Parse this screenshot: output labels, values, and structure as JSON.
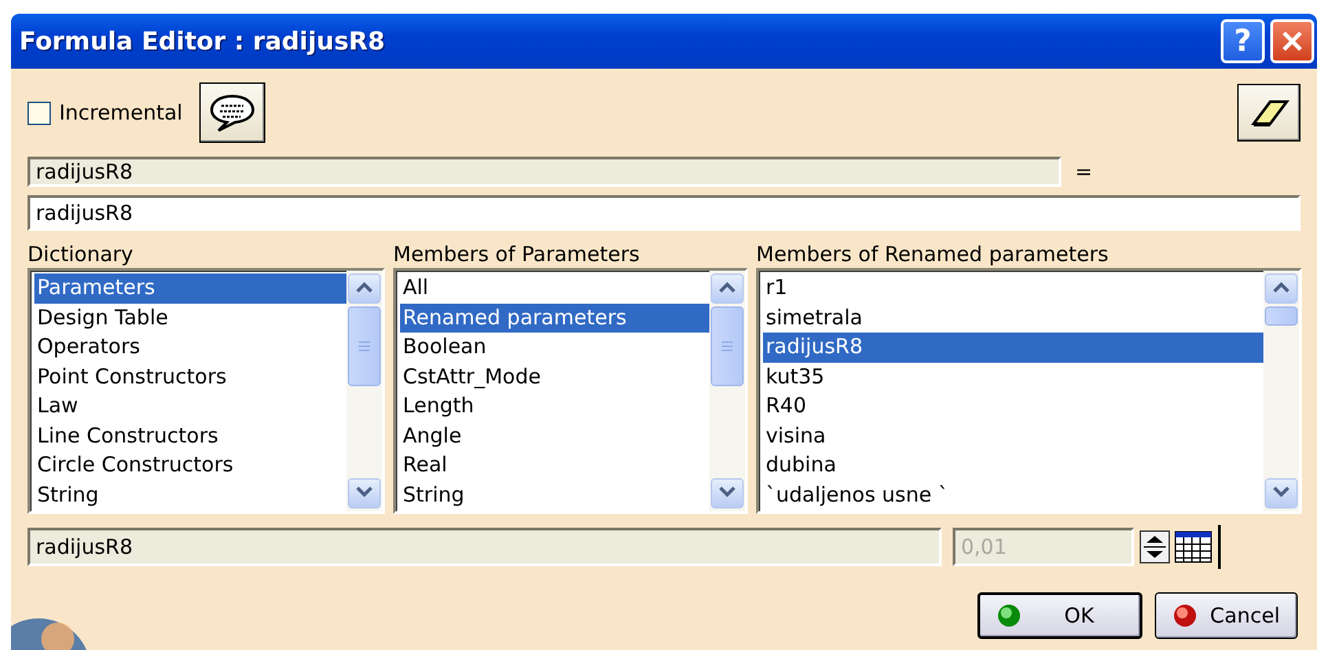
{
  "window": {
    "title": "Formula Editor : radijusR8",
    "help_button": "?"
  },
  "incremental": {
    "label": "Incremental",
    "checked": false
  },
  "parameter_field": {
    "value": "radijusR8"
  },
  "equals": "=",
  "formula_field": {
    "value": "radijusR8"
  },
  "lists": [
    {
      "label": "Dictionary",
      "items": [
        {
          "text": "Parameters",
          "selected": true
        },
        {
          "text": "Design Table",
          "selected": false
        },
        {
          "text": "Operators",
          "selected": false
        },
        {
          "text": "Point Constructors",
          "selected": false
        },
        {
          "text": "Law",
          "selected": false
        },
        {
          "text": "Line Constructors",
          "selected": false
        },
        {
          "text": "Circle Constructors",
          "selected": false
        },
        {
          "text": "String",
          "selected": false
        }
      ]
    },
    {
      "label": "Members of Parameters",
      "items": [
        {
          "text": "All",
          "selected": false
        },
        {
          "text": "Renamed parameters",
          "selected": true
        },
        {
          "text": "Boolean",
          "selected": false
        },
        {
          "text": "CstAttr_Mode",
          "selected": false
        },
        {
          "text": "Length",
          "selected": false
        },
        {
          "text": "Angle",
          "selected": false
        },
        {
          "text": "Real",
          "selected": false
        },
        {
          "text": "String",
          "selected": false
        }
      ]
    },
    {
      "label": "Members of Renamed parameters",
      "items": [
        {
          "text": "r1",
          "selected": false
        },
        {
          "text": "simetrala",
          "selected": false
        },
        {
          "text": "radijusR8",
          "selected": true
        },
        {
          "text": "kut35",
          "selected": false
        },
        {
          "text": "R40",
          "selected": false
        },
        {
          "text": "visina",
          "selected": false
        },
        {
          "text": "dubina",
          "selected": false
        },
        {
          "text": "`udaljenos usne `",
          "selected": false
        }
      ]
    }
  ],
  "selection_field": {
    "value": "radijusR8"
  },
  "step_field": {
    "value": "0,01",
    "disabled": true
  },
  "buttons": [
    {
      "label": "OK",
      "kind": "ok"
    },
    {
      "label": "Cancel",
      "kind": "cancel"
    }
  ]
}
